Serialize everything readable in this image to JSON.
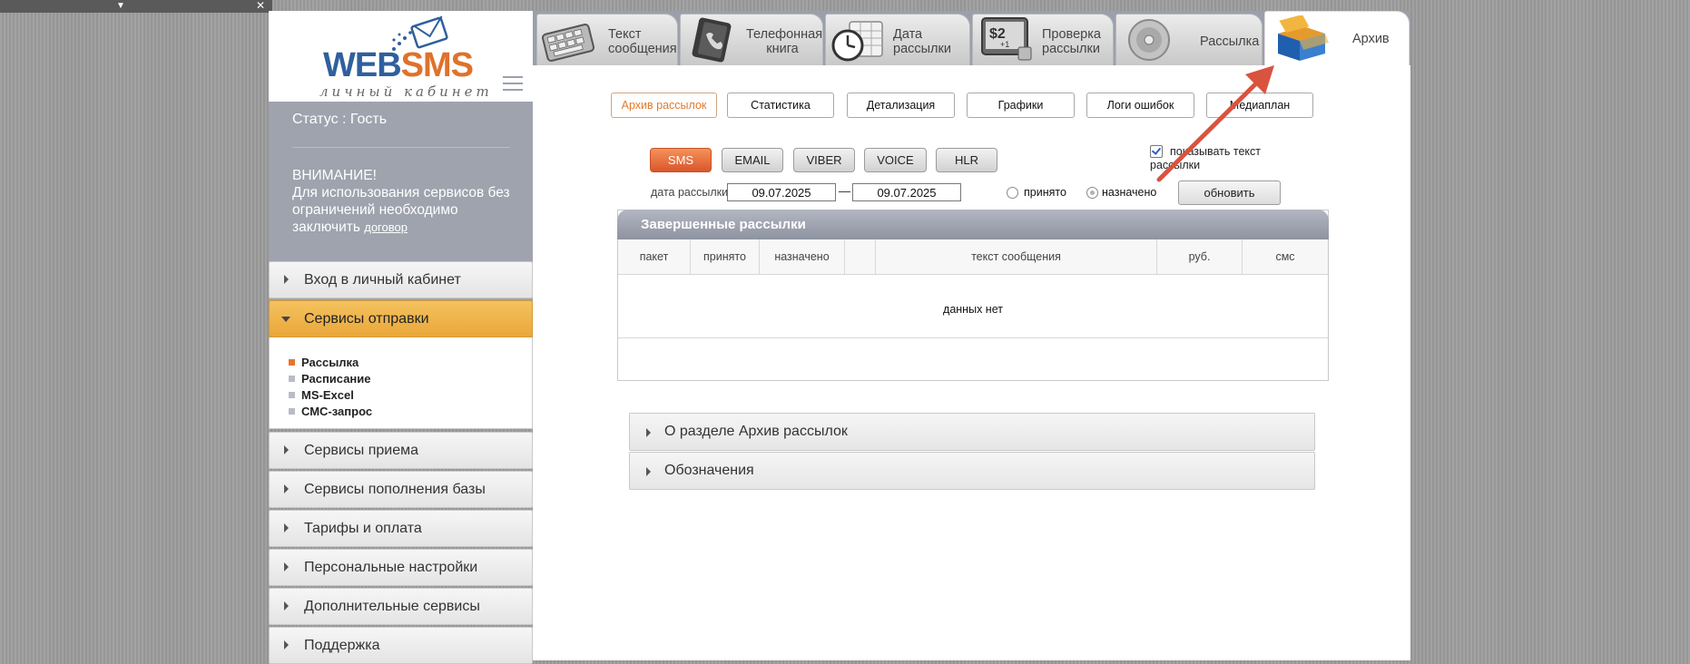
{
  "window": {
    "collapse_icon": "chevron-down-icon",
    "close_glyph": "✕"
  },
  "logo": {
    "brand_web": "WEB",
    "brand_sms": "SMS",
    "subtitle": "личный кабинет"
  },
  "status": {
    "text": "Статус : Гость",
    "warning_title": "ВНИМАНИЕ!",
    "warning_text": "Для использования сервисов без ограничений необходимо заключить",
    "warning_link": "договор"
  },
  "sidebar": {
    "items": [
      {
        "label": "Вход в личный кабинет"
      },
      {
        "label": "Сервисы отправки"
      },
      {
        "label": "Сервисы приема"
      },
      {
        "label": "Сервисы пополнения базы"
      },
      {
        "label": "Тарифы и оплата"
      },
      {
        "label": "Персональные настройки"
      },
      {
        "label": "Дополнительные сервисы"
      },
      {
        "label": "Поддержка"
      }
    ],
    "submenu": [
      {
        "label": "Рассылка"
      },
      {
        "label": "Расписание"
      },
      {
        "label": "MS-Excel"
      },
      {
        "label": "СМС-запрос"
      }
    ]
  },
  "tabs": [
    {
      "line1": "Текст",
      "line2": "сообщения",
      "icon": "keyboard-icon"
    },
    {
      "line1": "Телефонная",
      "line2": "книга",
      "icon": "phonebook-icon"
    },
    {
      "line1": "Дата",
      "line2": "рассылки",
      "icon": "calendar-clock-icon"
    },
    {
      "line1": "Проверка",
      "line2": "рассылки",
      "icon": "price-check-icon"
    },
    {
      "line1": "Рассылка",
      "line2": "",
      "icon": "disc-icon"
    },
    {
      "line1": "Архив",
      "line2": "",
      "icon": "archive-box-icon"
    }
  ],
  "subtabs": [
    "Архив рассылок",
    "Статистика",
    "Детализация",
    "Графики",
    "Логи ошибок",
    "Медиаплан"
  ],
  "channels": [
    "SMS",
    "EMAIL",
    "VIBER",
    "VOICE",
    "HLR"
  ],
  "show_text_checkbox": {
    "label": "показывать текст рассылки",
    "checked": true
  },
  "filter": {
    "date_label": "дата рассылки",
    "date_from": "09.07.2025",
    "date_sep": "—",
    "date_to": "09.07.2025",
    "radio_accepted": "принято",
    "radio_assigned": "назначено",
    "refresh": "обновить"
  },
  "table": {
    "title": "Завершенные рассылки",
    "columns": [
      "пакет",
      "принято",
      "назначено",
      "",
      "текст сообщения",
      "руб.",
      "смс"
    ],
    "empty": "данных нет"
  },
  "accordions": [
    "О разделе Архив рассылок",
    "Обозначения"
  ],
  "colors": {
    "accent": "#e8742b",
    "annotation_arrow": "#d9533f",
    "sidebar_panel": "#9ea3ae"
  }
}
